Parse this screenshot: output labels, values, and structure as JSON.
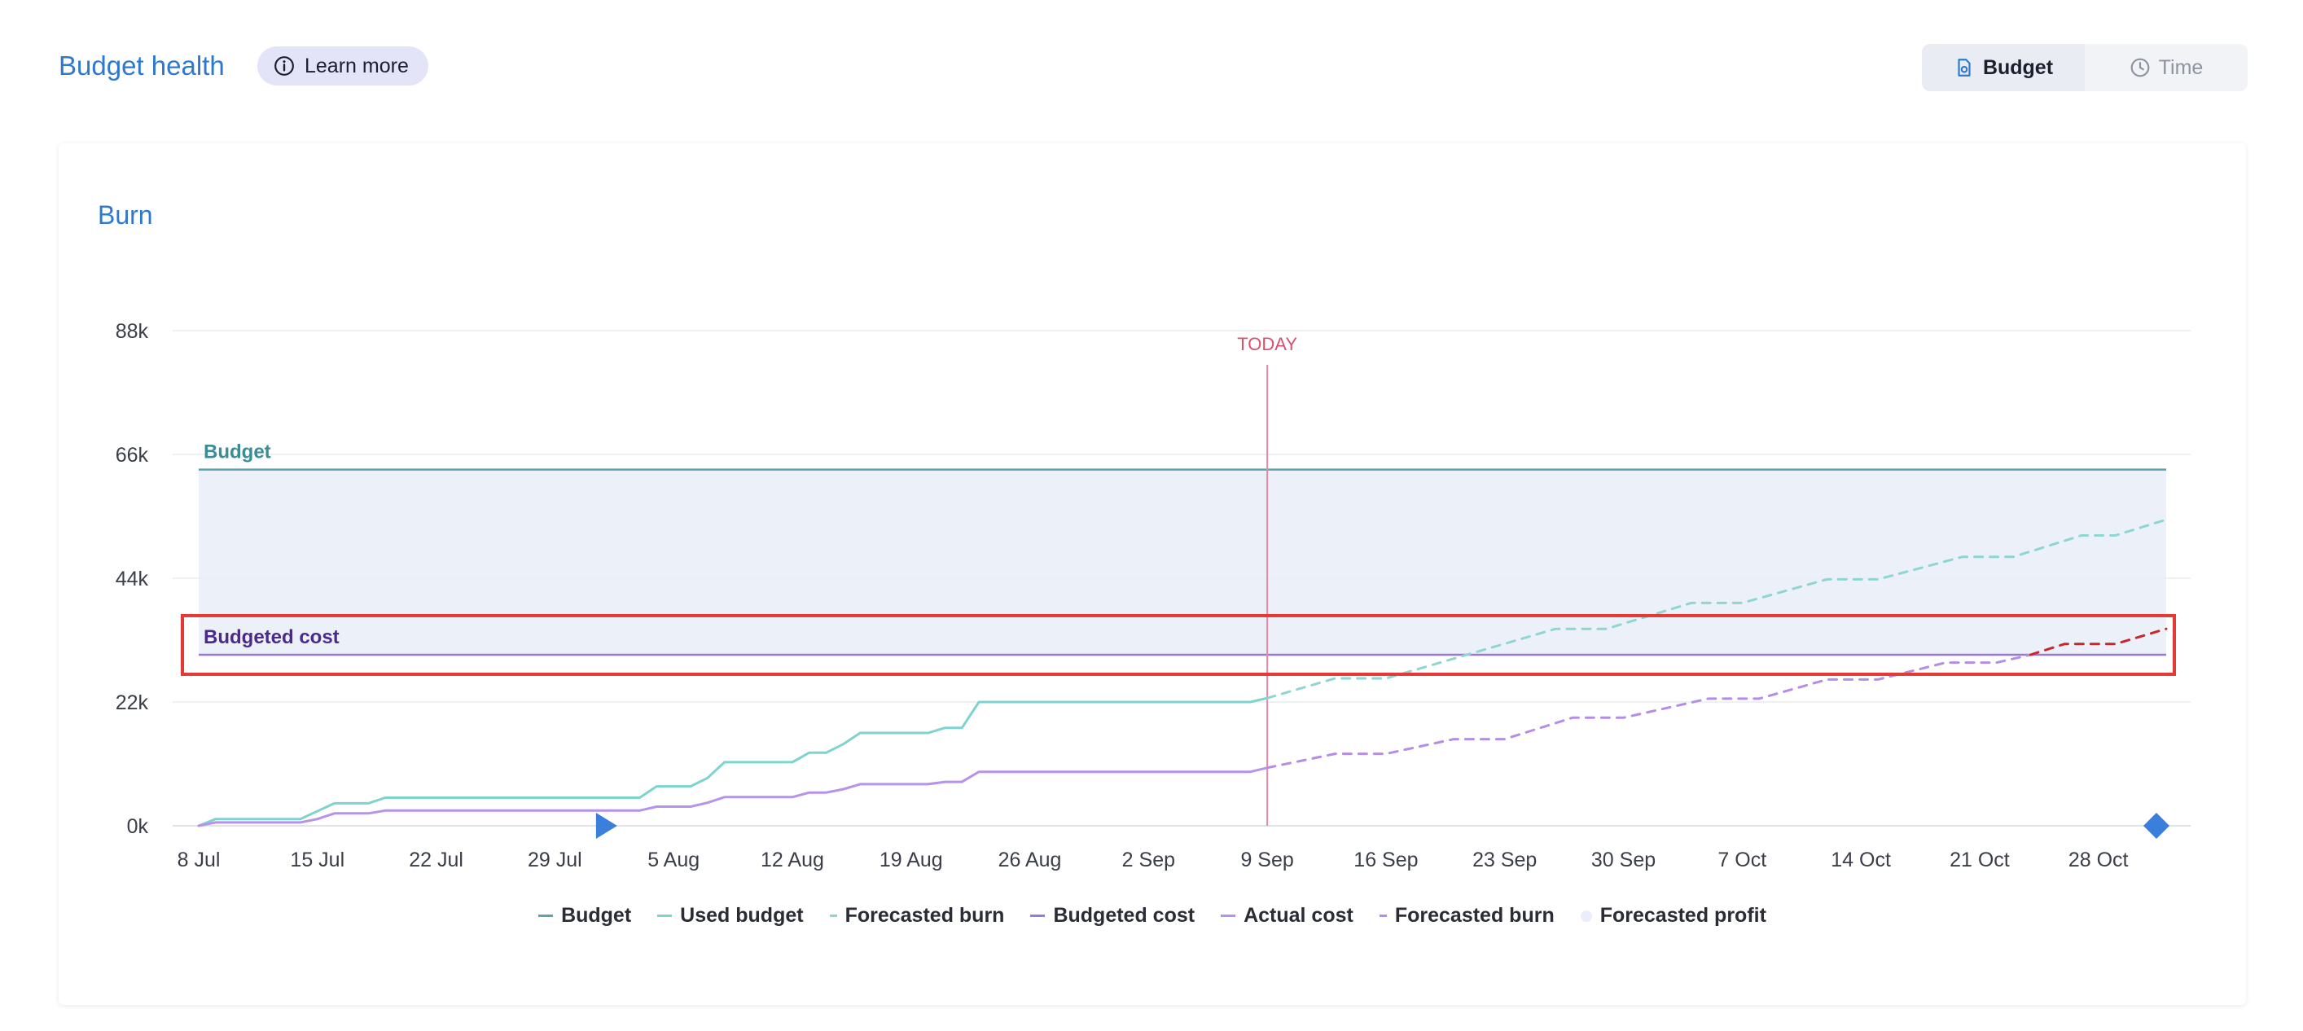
{
  "header": {
    "title": "Budget health",
    "learn_more": "Learn more",
    "toggle": {
      "budget": "Budget",
      "time": "Time"
    }
  },
  "card": {
    "title": "Burn"
  },
  "colors": {
    "budget": "#5aa5ab",
    "used_budget": "#7ed3cf",
    "forecast_teal": "#8fd6d2",
    "budgeted_cost": "#9a78d6",
    "actual_cost": "#b792ea",
    "forecast_purple": "#b48ee6",
    "forecast_profit": "#e9eef8",
    "overrun": "#c62828",
    "today": "#e48aa6",
    "highlight": "#e53935",
    "marker": "#3a7fdc"
  },
  "chart_data": {
    "type": "line",
    "title": "Burn",
    "ylim": [
      0,
      88000
    ],
    "y_ticks": [
      {
        "value": 0,
        "label": "0k"
      },
      {
        "value": 22000,
        "label": "22k"
      },
      {
        "value": 44000,
        "label": "44k"
      },
      {
        "value": 66000,
        "label": "66k"
      },
      {
        "value": 88000,
        "label": "88k"
      }
    ],
    "x_start": "2024-07-08",
    "x_end": "2024-11-01",
    "x_ticks": [
      {
        "date": "2024-07-08",
        "label": "8 Jul"
      },
      {
        "date": "2024-07-15",
        "label": "15 Jul"
      },
      {
        "date": "2024-07-22",
        "label": "22 Jul"
      },
      {
        "date": "2024-07-29",
        "label": "29 Jul"
      },
      {
        "date": "2024-08-05",
        "label": "5 Aug"
      },
      {
        "date": "2024-08-12",
        "label": "12 Aug"
      },
      {
        "date": "2024-08-19",
        "label": "19 Aug"
      },
      {
        "date": "2024-08-26",
        "label": "26 Aug"
      },
      {
        "date": "2024-09-02",
        "label": "2 Sep"
      },
      {
        "date": "2024-09-09",
        "label": "9 Sep"
      },
      {
        "date": "2024-09-16",
        "label": "16 Sep"
      },
      {
        "date": "2024-09-23",
        "label": "23 Sep"
      },
      {
        "date": "2024-09-30",
        "label": "30 Sep"
      },
      {
        "date": "2024-10-07",
        "label": "7 Oct"
      },
      {
        "date": "2024-10-14",
        "label": "14 Oct"
      },
      {
        "date": "2024-10-21",
        "label": "21 Oct"
      },
      {
        "date": "2024-10-28",
        "label": "28 Oct"
      }
    ],
    "today": {
      "date": "2024-09-09",
      "label": "TODAY"
    },
    "budget": {
      "label": "Budget",
      "value": 63300
    },
    "budgeted_cost": {
      "label": "Budgeted cost",
      "value": 30400
    },
    "series": [
      {
        "name": "Used budget",
        "points": [
          [
            "2024-07-08",
            0
          ],
          [
            "2024-07-09",
            1200
          ],
          [
            "2024-07-14",
            1200
          ],
          [
            "2024-07-16",
            4000
          ],
          [
            "2024-07-18",
            4000
          ],
          [
            "2024-07-19",
            5000
          ],
          [
            "2024-08-03",
            5000
          ],
          [
            "2024-08-04",
            7000
          ],
          [
            "2024-08-06",
            7000
          ],
          [
            "2024-08-07",
            8500
          ],
          [
            "2024-08-08",
            11300
          ],
          [
            "2024-08-12",
            11300
          ],
          [
            "2024-08-13",
            13000
          ],
          [
            "2024-08-14",
            13000
          ],
          [
            "2024-08-15",
            14500
          ],
          [
            "2024-08-16",
            16500
          ],
          [
            "2024-08-20",
            16500
          ],
          [
            "2024-08-21",
            17400
          ],
          [
            "2024-08-22",
            17400
          ],
          [
            "2024-08-23",
            22000
          ],
          [
            "2024-09-08",
            22000
          ],
          [
            "2024-09-09",
            22700
          ]
        ]
      },
      {
        "name": "Forecasted burn",
        "points": [
          [
            "2024-09-09",
            22700
          ],
          [
            "2024-09-13",
            26200
          ],
          [
            "2024-09-16",
            26200
          ],
          [
            "2024-09-26",
            35000
          ],
          [
            "2024-09-29",
            35000
          ],
          [
            "2024-10-04",
            39600
          ],
          [
            "2024-10-07",
            39600
          ],
          [
            "2024-10-12",
            43800
          ],
          [
            "2024-10-15",
            43800
          ],
          [
            "2024-10-20",
            47800
          ],
          [
            "2024-10-23",
            47800
          ],
          [
            "2024-10-27",
            51600
          ],
          [
            "2024-10-29",
            51600
          ],
          [
            "2024-11-01",
            54400
          ]
        ]
      },
      {
        "name": "Actual cost",
        "points": [
          [
            "2024-07-08",
            0
          ],
          [
            "2024-07-09",
            600
          ],
          [
            "2024-07-14",
            600
          ],
          [
            "2024-07-15",
            1200
          ],
          [
            "2024-07-16",
            2200
          ],
          [
            "2024-07-18",
            2200
          ],
          [
            "2024-07-19",
            2700
          ],
          [
            "2024-08-03",
            2700
          ],
          [
            "2024-08-04",
            3400
          ],
          [
            "2024-08-06",
            3400
          ],
          [
            "2024-08-07",
            4100
          ],
          [
            "2024-08-08",
            5100
          ],
          [
            "2024-08-12",
            5100
          ],
          [
            "2024-08-13",
            5900
          ],
          [
            "2024-08-14",
            5900
          ],
          [
            "2024-08-15",
            6500
          ],
          [
            "2024-08-16",
            7400
          ],
          [
            "2024-08-20",
            7400
          ],
          [
            "2024-08-21",
            7800
          ],
          [
            "2024-08-22",
            7800
          ],
          [
            "2024-08-23",
            9600
          ],
          [
            "2024-09-08",
            9600
          ],
          [
            "2024-09-09",
            10300
          ]
        ]
      },
      {
        "name": "Forecasted burn",
        "points": [
          [
            "2024-09-09",
            10300
          ],
          [
            "2024-09-13",
            12800
          ],
          [
            "2024-09-16",
            12800
          ],
          [
            "2024-09-20",
            15400
          ],
          [
            "2024-09-23",
            15400
          ],
          [
            "2024-09-27",
            19200
          ],
          [
            "2024-09-30",
            19200
          ],
          [
            "2024-10-05",
            22600
          ],
          [
            "2024-10-08",
            22600
          ],
          [
            "2024-10-12",
            26000
          ],
          [
            "2024-10-15",
            26000
          ],
          [
            "2024-10-19",
            29000
          ],
          [
            "2024-10-22",
            29000
          ],
          [
            "2024-10-24",
            30400
          ]
        ]
      },
      {
        "name": "Forecasted burn (over budgeted cost)",
        "points": [
          [
            "2024-10-24",
            30400
          ],
          [
            "2024-10-26",
            32300
          ],
          [
            "2024-10-29",
            32300
          ],
          [
            "2024-11-01",
            35000
          ]
        ]
      }
    ],
    "markers": [
      {
        "type": "start",
        "date": "2024-08-01",
        "value": 0
      },
      {
        "type": "end",
        "date": "2024-11-01",
        "value": 0
      }
    ],
    "legend": [
      "Budget",
      "Used budget",
      "Forecasted burn",
      "Budgeted cost",
      "Actual cost",
      "Forecasted burn",
      "Forecasted profit"
    ],
    "legend_position": "bottom-center",
    "grid": true
  }
}
